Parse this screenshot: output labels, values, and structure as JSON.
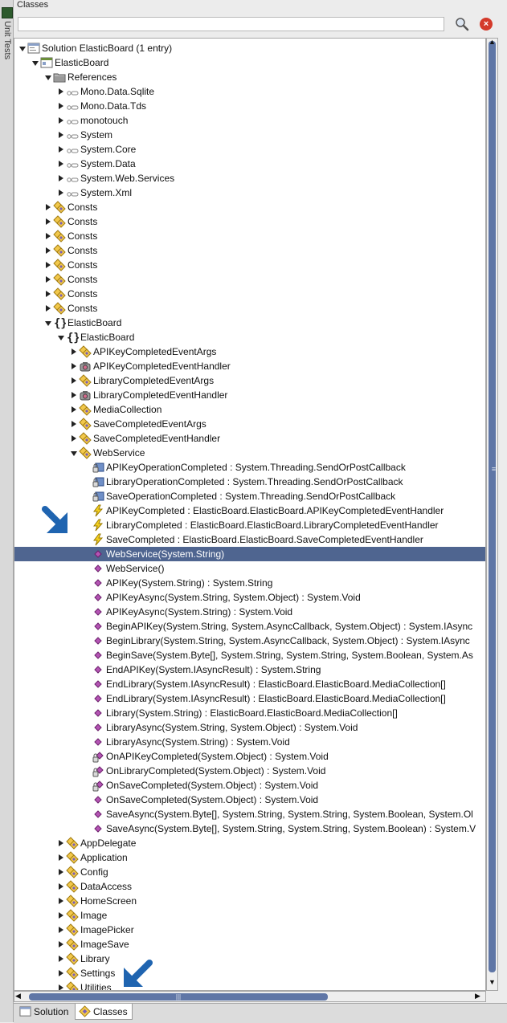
{
  "side_strip": {
    "label": "Unit Tests"
  },
  "panel": {
    "title": "Classes",
    "search_value": ""
  },
  "tabs": [
    {
      "label": "Solution",
      "active": false
    },
    {
      "label": "Classes",
      "active": true
    }
  ],
  "tree_rows": [
    {
      "indent": 0,
      "toggle": "expanded",
      "icon": "solution-icon",
      "label": "Solution ElasticBoard (1 entry)"
    },
    {
      "indent": 1,
      "toggle": "expanded",
      "icon": "project-icon",
      "label": "ElasticBoard"
    },
    {
      "indent": 2,
      "toggle": "expanded",
      "icon": "folder-icon",
      "label": "References"
    },
    {
      "indent": 3,
      "toggle": "collapsed",
      "icon": "reference-icon",
      "label": "Mono.Data.Sqlite"
    },
    {
      "indent": 3,
      "toggle": "collapsed",
      "icon": "reference-icon",
      "label": "Mono.Data.Tds"
    },
    {
      "indent": 3,
      "toggle": "collapsed",
      "icon": "reference-icon",
      "label": "monotouch"
    },
    {
      "indent": 3,
      "toggle": "collapsed",
      "icon": "reference-icon",
      "label": "System"
    },
    {
      "indent": 3,
      "toggle": "collapsed",
      "icon": "reference-icon",
      "label": "System.Core"
    },
    {
      "indent": 3,
      "toggle": "collapsed",
      "icon": "reference-icon",
      "label": "System.Data"
    },
    {
      "indent": 3,
      "toggle": "collapsed",
      "icon": "reference-icon",
      "label": "System.Web.Services"
    },
    {
      "indent": 3,
      "toggle": "collapsed",
      "icon": "reference-icon",
      "label": "System.Xml"
    },
    {
      "indent": 2,
      "toggle": "collapsed",
      "icon": "class-icon",
      "label": "Consts"
    },
    {
      "indent": 2,
      "toggle": "collapsed",
      "icon": "class-icon",
      "label": "Consts"
    },
    {
      "indent": 2,
      "toggle": "collapsed",
      "icon": "class-icon",
      "label": "Consts"
    },
    {
      "indent": 2,
      "toggle": "collapsed",
      "icon": "class-icon",
      "label": "Consts"
    },
    {
      "indent": 2,
      "toggle": "collapsed",
      "icon": "class-icon",
      "label": "Consts"
    },
    {
      "indent": 2,
      "toggle": "collapsed",
      "icon": "class-icon",
      "label": "Consts"
    },
    {
      "indent": 2,
      "toggle": "collapsed",
      "icon": "class-icon",
      "label": "Consts"
    },
    {
      "indent": 2,
      "toggle": "collapsed",
      "icon": "class-icon",
      "label": "Consts"
    },
    {
      "indent": 2,
      "toggle": "expanded",
      "icon": "namespace-icon",
      "label": "ElasticBoard"
    },
    {
      "indent": 3,
      "toggle": "expanded",
      "icon": "namespace-icon",
      "label": "ElasticBoard"
    },
    {
      "indent": 4,
      "toggle": "collapsed",
      "icon": "class-icon",
      "label": "APIKeyCompletedEventArgs"
    },
    {
      "indent": 4,
      "toggle": "collapsed",
      "icon": "delegate-icon",
      "label": "APIKeyCompletedEventHandler"
    },
    {
      "indent": 4,
      "toggle": "collapsed",
      "icon": "class-icon",
      "label": "LibraryCompletedEventArgs"
    },
    {
      "indent": 4,
      "toggle": "collapsed",
      "icon": "delegate-icon",
      "label": "LibraryCompletedEventHandler"
    },
    {
      "indent": 4,
      "toggle": "collapsed",
      "icon": "class-icon",
      "label": "MediaCollection"
    },
    {
      "indent": 4,
      "toggle": "collapsed",
      "icon": "class-icon",
      "label": "SaveCompletedEventArgs"
    },
    {
      "indent": 4,
      "toggle": "collapsed",
      "icon": "class-icon",
      "label": "SaveCompletedEventHandler"
    },
    {
      "indent": 4,
      "toggle": "expanded",
      "icon": "class-icon",
      "label": "WebService"
    },
    {
      "indent": 5,
      "toggle": "none",
      "icon": "private-field-icon",
      "label": "APIKeyOperationCompleted : System.Threading.SendOrPostCallback"
    },
    {
      "indent": 5,
      "toggle": "none",
      "icon": "private-field-icon",
      "label": "LibraryOperationCompleted : System.Threading.SendOrPostCallback"
    },
    {
      "indent": 5,
      "toggle": "none",
      "icon": "private-field-icon",
      "label": "SaveOperationCompleted : System.Threading.SendOrPostCallback"
    },
    {
      "indent": 5,
      "toggle": "none",
      "icon": "event-icon",
      "label": "APIKeyCompleted : ElasticBoard.ElasticBoard.APIKeyCompletedEventHandler"
    },
    {
      "indent": 5,
      "toggle": "none",
      "icon": "event-icon",
      "label": "LibraryCompleted : ElasticBoard.ElasticBoard.LibraryCompletedEventHandler"
    },
    {
      "indent": 5,
      "toggle": "none",
      "icon": "event-icon",
      "label": "SaveCompleted : ElasticBoard.ElasticBoard.SaveCompletedEventHandler"
    },
    {
      "indent": 5,
      "toggle": "none",
      "icon": "method-icon",
      "label": "WebService(System.String)",
      "selected": true
    },
    {
      "indent": 5,
      "toggle": "none",
      "icon": "method-icon",
      "label": "WebService()"
    },
    {
      "indent": 5,
      "toggle": "none",
      "icon": "method-icon",
      "label": "APIKey(System.String) : System.String"
    },
    {
      "indent": 5,
      "toggle": "none",
      "icon": "method-icon",
      "label": "APIKeyAsync(System.String, System.Object) : System.Void"
    },
    {
      "indent": 5,
      "toggle": "none",
      "icon": "method-icon",
      "label": "APIKeyAsync(System.String) : System.Void"
    },
    {
      "indent": 5,
      "toggle": "none",
      "icon": "method-icon",
      "label": "BeginAPIKey(System.String, System.AsyncCallback, System.Object) : System.IAsync"
    },
    {
      "indent": 5,
      "toggle": "none",
      "icon": "method-icon",
      "label": "BeginLibrary(System.String, System.AsyncCallback, System.Object) : System.IAsync"
    },
    {
      "indent": 5,
      "toggle": "none",
      "icon": "method-icon",
      "label": "BeginSave(System.Byte[], System.String, System.String, System.Boolean, System.As"
    },
    {
      "indent": 5,
      "toggle": "none",
      "icon": "method-icon",
      "label": "EndAPIKey(System.IAsyncResult) : System.String"
    },
    {
      "indent": 5,
      "toggle": "none",
      "icon": "method-icon",
      "label": "EndLibrary(System.IAsyncResult) : ElasticBoard.ElasticBoard.MediaCollection[]"
    },
    {
      "indent": 5,
      "toggle": "none",
      "icon": "method-icon",
      "label": "EndLibrary(System.IAsyncResult) : ElasticBoard.ElasticBoard.MediaCollection[]"
    },
    {
      "indent": 5,
      "toggle": "none",
      "icon": "method-icon",
      "label": "Library(System.String) : ElasticBoard.ElasticBoard.MediaCollection[]"
    },
    {
      "indent": 5,
      "toggle": "none",
      "icon": "method-icon",
      "label": "LibraryAsync(System.String, System.Object) : System.Void"
    },
    {
      "indent": 5,
      "toggle": "none",
      "icon": "method-icon",
      "label": "LibraryAsync(System.String) : System.Void"
    },
    {
      "indent": 5,
      "toggle": "none",
      "icon": "private-method-icon",
      "label": "OnAPIKeyCompleted(System.Object) : System.Void"
    },
    {
      "indent": 5,
      "toggle": "none",
      "icon": "private-method-icon",
      "label": "OnLibraryCompleted(System.Object) : System.Void"
    },
    {
      "indent": 5,
      "toggle": "none",
      "icon": "private-method-icon",
      "label": "OnSaveCompleted(System.Object) : System.Void"
    },
    {
      "indent": 5,
      "toggle": "none",
      "icon": "method-icon",
      "label": "OnSaveCompleted(System.Object) : System.Void"
    },
    {
      "indent": 5,
      "toggle": "none",
      "icon": "method-icon",
      "label": "SaveAsync(System.Byte[], System.String, System.String, System.Boolean, System.Ol"
    },
    {
      "indent": 5,
      "toggle": "none",
      "icon": "method-icon",
      "label": "SaveAsync(System.Byte[], System.String, System.String, System.Boolean) : System.V"
    },
    {
      "indent": 3,
      "toggle": "collapsed",
      "icon": "class-icon",
      "label": "AppDelegate"
    },
    {
      "indent": 3,
      "toggle": "collapsed",
      "icon": "class-icon",
      "label": "Application"
    },
    {
      "indent": 3,
      "toggle": "collapsed",
      "icon": "class-icon",
      "label": "Config"
    },
    {
      "indent": 3,
      "toggle": "collapsed",
      "icon": "class-icon",
      "label": "DataAccess"
    },
    {
      "indent": 3,
      "toggle": "collapsed",
      "icon": "class-icon",
      "label": "HomeScreen"
    },
    {
      "indent": 3,
      "toggle": "collapsed",
      "icon": "class-icon",
      "label": "Image"
    },
    {
      "indent": 3,
      "toggle": "collapsed",
      "icon": "class-icon",
      "label": "ImagePicker"
    },
    {
      "indent": 3,
      "toggle": "collapsed",
      "icon": "class-icon",
      "label": "ImageSave"
    },
    {
      "indent": 3,
      "toggle": "collapsed",
      "icon": "class-icon",
      "label": "Library"
    },
    {
      "indent": 3,
      "toggle": "collapsed",
      "icon": "class-icon",
      "label": "Settings"
    },
    {
      "indent": 3,
      "toggle": "collapsed",
      "icon": "class-icon",
      "label": "Utilities"
    }
  ],
  "colors": {
    "selection": "#4f6590",
    "scrollbar_thumb": "#5f76a6",
    "annotation_arrow": "#1f64b0"
  }
}
